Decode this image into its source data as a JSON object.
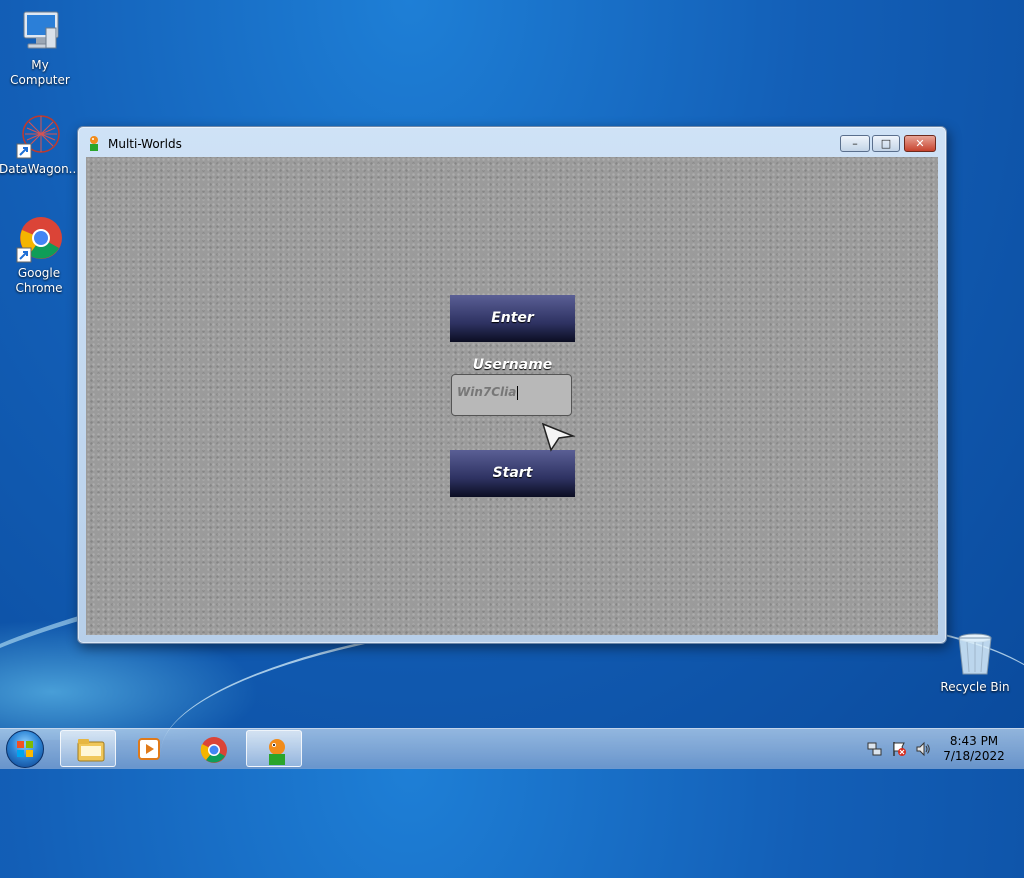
{
  "desktop": {
    "icons": [
      {
        "label": "My Computer"
      },
      {
        "label": "DataWagon..."
      },
      {
        "label": "Google Chrome"
      },
      {
        "label": "Recycle Bin"
      }
    ]
  },
  "window": {
    "title": "Multi-Worlds",
    "controls": {
      "minimize": "–",
      "maximize": "□",
      "close": "✕"
    }
  },
  "game": {
    "username_label": "Enter Username",
    "username_value": "Win7Clia",
    "start_label": "Start"
  },
  "taskbar": {
    "items": [
      {
        "icon": "folder-icon"
      },
      {
        "icon": "media-player-icon"
      },
      {
        "icon": "chrome-icon"
      },
      {
        "icon": "multi-worlds-icon",
        "active": true
      }
    ],
    "clock": {
      "time": "8:43 PM",
      "date": "7/18/2022"
    }
  },
  "colors": {
    "desktop": "#135fb7",
    "game_bg": "#9b9b9b",
    "button_top": "#5a5f95",
    "button_bottom": "#0b0d22"
  }
}
